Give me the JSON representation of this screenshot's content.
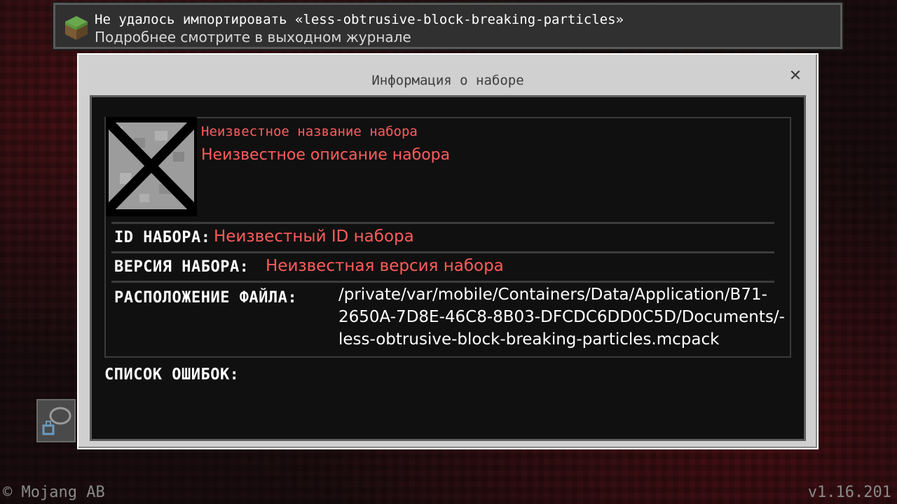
{
  "toast": {
    "title": "Не удалось импортировать «less-obtrusive-block-breaking-particles»",
    "subtitle": "Подробнее смотрите в выходном журнале",
    "icon": "grass-block-icon"
  },
  "dialog": {
    "title": "Информация о наборе",
    "close_icon": "close-icon",
    "pack": {
      "icon": "unknown-pack-icon",
      "name": "Неизвестное название набора",
      "description": "Неизвестное описание набора"
    },
    "rows": [
      {
        "label": "ID набора:",
        "value": "Неизвестный ID набора"
      },
      {
        "label": "Версия набора:",
        "value": "Неизвестная версия набора"
      },
      {
        "label": "Расположение файла:",
        "value": "/private/var/mobile/Containers/Data/Application/B71-2650A-7D8E-46C8-8B03-DFCDC6DD0C5D/Documents/-less-obtrusive-block-breaking-particles.mcpack"
      }
    ],
    "errors_label": "СПИСОК ОШИБОК:"
  },
  "footer": {
    "copyright": "© Mojang AB",
    "version": "v1.16.201"
  },
  "colors": {
    "error_red": "#ff5c5c",
    "dialog_frame": "#d0d0d0",
    "panel_bg": "#101010"
  }
}
